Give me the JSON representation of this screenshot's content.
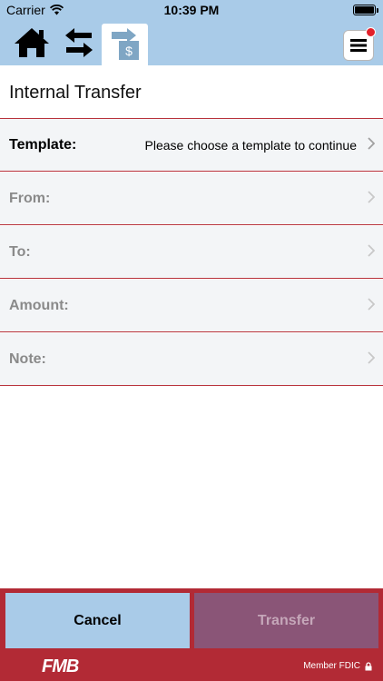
{
  "status_bar": {
    "carrier": "Carrier",
    "time": "10:39 PM"
  },
  "nav": {
    "home_icon": "home-icon",
    "swap_icon": "swap-arrows-icon",
    "transfer_icon": "transfer-dollar-icon",
    "menu_icon": "hamburger-menu-icon",
    "has_notification": true
  },
  "page": {
    "title": "Internal Transfer"
  },
  "form": {
    "rows": [
      {
        "label": "Template:",
        "value": "Please choose a template to continue",
        "enabled": true
      },
      {
        "label": "From:",
        "value": "",
        "enabled": false
      },
      {
        "label": "To:",
        "value": "",
        "enabled": false
      },
      {
        "label": "Amount:",
        "value": "",
        "enabled": false
      },
      {
        "label": "Note:",
        "value": "",
        "enabled": false
      }
    ]
  },
  "buttons": {
    "cancel": "Cancel",
    "transfer": "Transfer"
  },
  "footer": {
    "logo": "FMB",
    "fdic": "Member FDIC"
  },
  "colors": {
    "header_blue": "#a9cbe8",
    "accent_red": "#b22a35",
    "transfer_disabled": "#8a5577"
  }
}
